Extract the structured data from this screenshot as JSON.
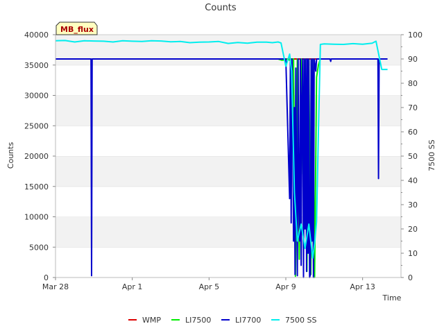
{
  "chart_data": {
    "type": "line",
    "title": "Counts",
    "xlabel": "Time",
    "ylabel": "Counts",
    "y2label": "7500 SS",
    "badge": "MB_flux",
    "x_ticks": [
      {
        "label": "Mar 28",
        "day": 0
      },
      {
        "label": "Apr 1",
        "day": 4
      },
      {
        "label": "Apr 5",
        "day": 8
      },
      {
        "label": "Apr 9",
        "day": 12
      },
      {
        "label": "Apr 13",
        "day": 16
      }
    ],
    "xlim_days": [
      0,
      18
    ],
    "ylim": [
      0,
      40000
    ],
    "y_ticks": [
      0,
      5000,
      10000,
      15000,
      20000,
      25000,
      30000,
      35000,
      40000
    ],
    "y2lim": [
      0,
      100
    ],
    "y2_ticks": [
      0,
      10,
      20,
      30,
      40,
      50,
      60,
      70,
      80,
      90,
      100
    ],
    "grid": "horizontal bands",
    "legend_position": "bottom",
    "series": [
      {
        "name": "WMP",
        "color": "#dd0000",
        "axis": "left",
        "x": [
          11.4,
          13.8
        ],
        "y": [
          36000,
          36000
        ]
      },
      {
        "name": "LI7500",
        "color": "#00ee00",
        "axis": "left",
        "x": [
          11.4,
          11.6,
          11.8,
          12.0,
          12.1,
          12.2,
          12.3,
          12.4,
          12.5,
          12.6,
          12.7,
          12.8,
          12.9,
          13.0,
          13.1,
          13.2,
          13.3,
          13.4,
          13.5,
          13.6,
          13.7,
          13.8
        ],
        "y": [
          36000,
          36000,
          35800,
          35900,
          36000,
          35800,
          36000,
          36000,
          200,
          36000,
          3000,
          36000,
          17000,
          36000,
          1000,
          36000,
          500,
          36000,
          0,
          33000,
          35000,
          36000
        ]
      },
      {
        "name": "LI7700",
        "color": "#0000cc",
        "axis": "left",
        "x": [
          0.0,
          1.85,
          1.88,
          1.91,
          12.0,
          12.2,
          12.24,
          12.28,
          12.32,
          12.36,
          12.4,
          12.44,
          12.48,
          12.52,
          12.56,
          12.6,
          12.64,
          12.68,
          12.72,
          12.76,
          12.8,
          12.84,
          12.88,
          12.92,
          12.96,
          13.0,
          13.04,
          13.08,
          13.12,
          13.16,
          13.2,
          13.24,
          13.28,
          13.32,
          13.36,
          13.4,
          13.44,
          13.48,
          13.52,
          13.56,
          13.6,
          13.64,
          13.68,
          13.72,
          13.76,
          13.8,
          14.3,
          14.32,
          14.34,
          14.36,
          16.8,
          16.83,
          16.86,
          16.89,
          17.3
        ],
        "y": [
          36000,
          36000,
          300,
          36000,
          36000,
          13000,
          36000,
          9000,
          36000,
          26000,
          6000,
          28000,
          500,
          34500,
          15000,
          300,
          36000,
          12000,
          6000,
          36000,
          2000,
          30000,
          36000,
          0,
          36000,
          8000,
          36000,
          1000,
          36000,
          4000,
          36000,
          0,
          500,
          36000,
          6000,
          36000,
          0,
          36000,
          35000,
          34000,
          36000,
          36000,
          36000,
          36000,
          36000,
          36000,
          36000,
          35800,
          35600,
          36000,
          36000,
          16300,
          36000,
          36000,
          36000
        ]
      },
      {
        "name": "7500 SS",
        "color": "#00eeee",
        "axis": "right",
        "x": [
          0.0,
          0.5,
          1.0,
          1.5,
          2.0,
          2.5,
          3.0,
          3.5,
          4.0,
          4.5,
          5.0,
          5.5,
          6.0,
          6.5,
          7.0,
          7.5,
          8.0,
          8.5,
          9.0,
          9.5,
          10.0,
          10.5,
          11.0,
          11.3,
          11.6,
          11.75,
          12.0,
          12.2,
          12.3,
          12.45,
          12.6,
          12.8,
          13.0,
          13.2,
          13.4,
          13.5,
          13.6,
          13.7,
          13.8,
          14.0,
          14.5,
          15.0,
          15.5,
          16.0,
          16.5,
          16.7,
          17.0,
          17.3
        ],
        "y": [
          97.5,
          97.6,
          97.0,
          97.5,
          97.4,
          97.3,
          97.0,
          97.5,
          97.3,
          97.2,
          97.5,
          97.4,
          97.1,
          97.2,
          96.7,
          96.9,
          97.0,
          97.2,
          96.4,
          96.8,
          96.5,
          96.9,
          96.9,
          96.7,
          97.0,
          96.6,
          87.0,
          92.0,
          85.0,
          35.0,
          15.0,
          22.0,
          12.0,
          22.0,
          8.0,
          14.0,
          23.0,
          60.0,
          96.0,
          96.2,
          96.1,
          96.0,
          96.3,
          96.1,
          96.5,
          97.3,
          85.7,
          85.7
        ]
      }
    ]
  }
}
